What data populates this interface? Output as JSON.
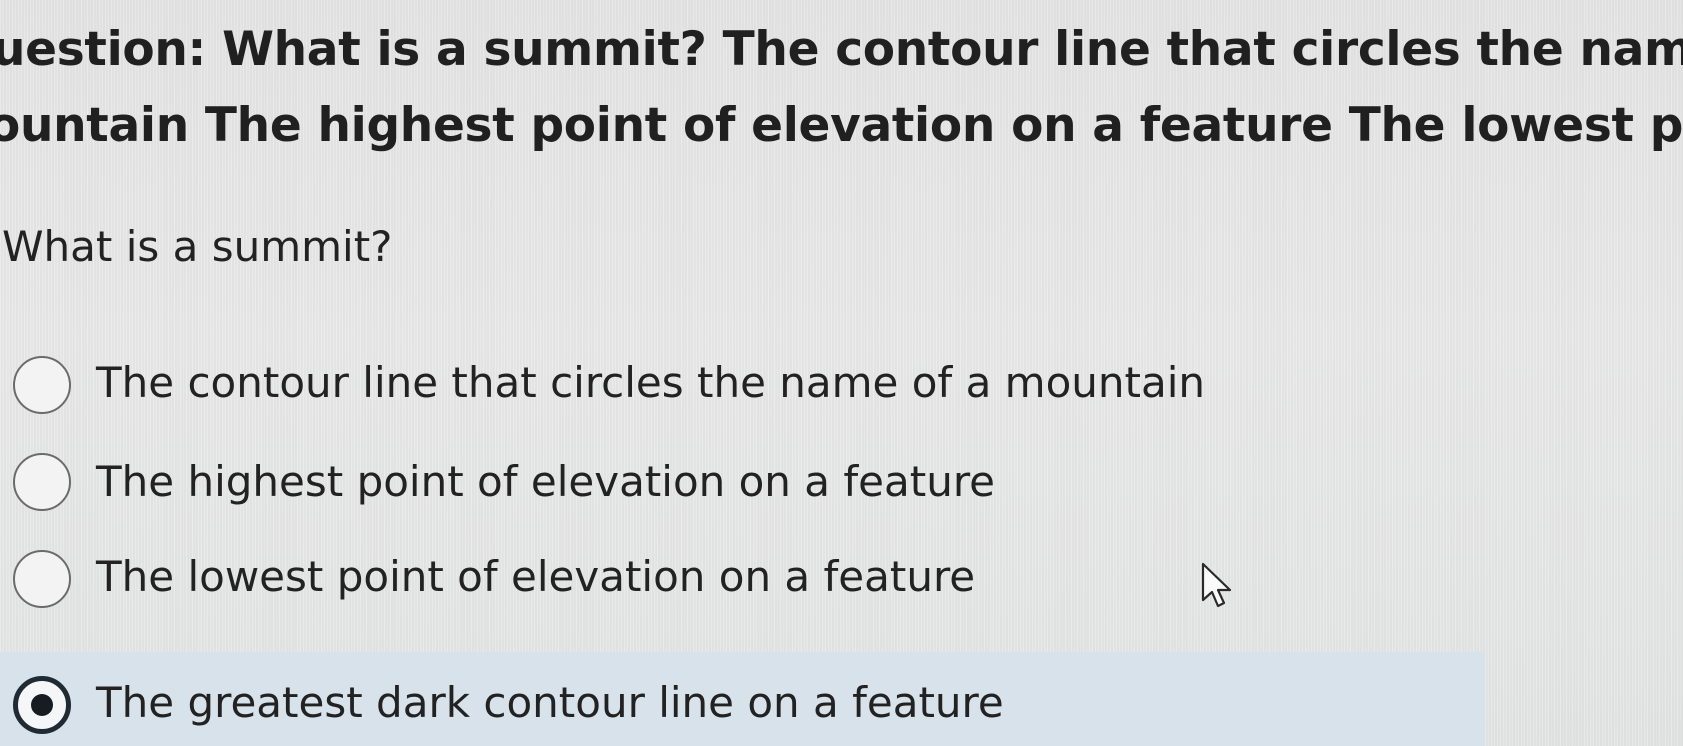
{
  "question": {
    "title_line1": "uestion: What is a summit? The contour line that circles the name of",
    "title_line2": "ountain The highest point of elevation on a feature The lowest point",
    "prompt": "What is a summit?"
  },
  "options": [
    {
      "label": "The contour line that circles the name of a mountain",
      "selected": false
    },
    {
      "label": "The highest point of elevation on a feature",
      "selected": false
    },
    {
      "label": "The lowest point of elevation on a feature",
      "selected": false
    },
    {
      "label": "The greatest dark contour line on a feature",
      "selected": true
    }
  ],
  "colors": {
    "background": "#e6e6e6",
    "selected_row": "#d8e2ea",
    "radio_selected": "#1f2a33",
    "text": "#222222"
  },
  "icons": {
    "cursor": "mouse-pointer-icon",
    "radio": "radio-button-icon"
  }
}
